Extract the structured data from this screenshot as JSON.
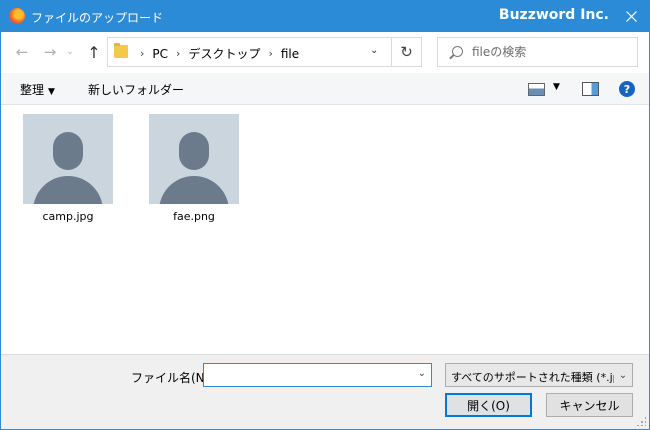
{
  "window": {
    "title": "ファイルのアップロード",
    "brand": "Buzzword Inc."
  },
  "icons": {
    "app": "firefox-icon",
    "close": "close-icon",
    "back": "back-arrow-icon",
    "forward": "forward-arrow-icon",
    "up": "up-arrow-icon",
    "refresh": "refresh-icon",
    "search": "search-icon",
    "help": "help-icon"
  },
  "nav": {
    "breadcrumbs": [
      "PC",
      "デスクトップ",
      "file"
    ],
    "search_placeholder": "fileの検索"
  },
  "toolbar": {
    "organize": "整理",
    "new_folder": "新しいフォルダー"
  },
  "files": [
    {
      "name": "camp.jpg"
    },
    {
      "name": "fae.png"
    }
  ],
  "footer": {
    "filename_label": "ファイル名(N):",
    "filename_value": "",
    "filetype": "すべてのサポートされた種類 (*.jpg;*",
    "open_button": "開く(O)",
    "cancel_button": "キャンセル"
  },
  "colors": {
    "titlebar": "#2b8bd6",
    "accent": "#0078d7",
    "thumbnail_bg": "#cbd5de",
    "thumbnail_fg": "#6c7b8c"
  }
}
